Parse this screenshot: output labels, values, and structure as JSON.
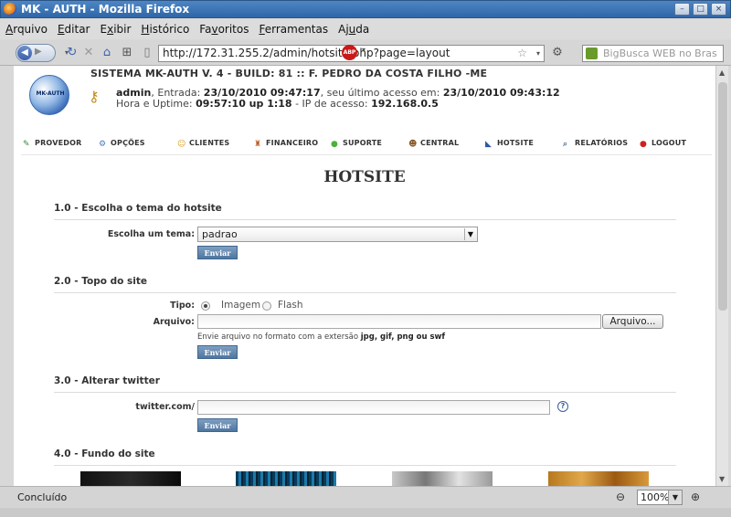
{
  "window": {
    "title": "MK - AUTH - Mozilla Firefox",
    "buttons": [
      "–",
      "□",
      "×"
    ]
  },
  "menubar": {
    "items": [
      {
        "accel": "A",
        "rest": "rquivo"
      },
      {
        "accel": "E",
        "rest": "ditar"
      },
      {
        "accel": "x",
        "pre": "E",
        "rest": "ibir"
      },
      {
        "accel": "H",
        "rest": "istórico"
      },
      {
        "accel": "v",
        "pre": "Fa",
        "rest": "oritos"
      },
      {
        "accel": "F",
        "rest": "erramentas"
      },
      {
        "accel": "u",
        "pre": "Aj",
        "rest": "da"
      }
    ]
  },
  "toolbar": {
    "url": "http://172.31.255.2/admin/hotsite.php?page=layout",
    "search_placeholder": "BigBusca WEB no Bras",
    "icons": [
      "back-icon",
      "forward-icon",
      "reload-icon",
      "stop-icon",
      "home-icon",
      "add-bookmark-icon",
      "page-icon",
      "star-icon",
      "adblock-icon",
      "addon-icon",
      "search-engine-icon"
    ],
    "adblock_label": "ABP"
  },
  "header": {
    "logo_text": "MK-AUTH",
    "system_title": "SISTEMA MK-AUTH V. 4 - BUILD: 81 :: F. PEDRO DA COSTA FILHO -ME",
    "user": "admin",
    "entrada_label": ", Entrada: ",
    "entrada": "23/10/2010 09:47:17",
    "last_access_label": ", seu último acesso em: ",
    "last_access": "23/10/2010 09:43:12",
    "uptime_label": "Hora e Uptime: ",
    "uptime": "09:57:10 up 1:18",
    "ip_label": " - IP de acesso: ",
    "ip": "192.168.0.5"
  },
  "topmenu": [
    {
      "label": "PROVEDOR",
      "icon": "provider-icon",
      "color": "#3a8a3a"
    },
    {
      "label": "OPÇÕES",
      "icon": "options-icon",
      "color": "#4a7abf"
    },
    {
      "label": "CLIENTES",
      "icon": "clients-icon",
      "color": "#d0a020"
    },
    {
      "label": "FINANCEIRO",
      "icon": "finance-icon",
      "color": "#c05a20"
    },
    {
      "label": "SUPORTE",
      "icon": "support-icon",
      "color": "#4cb03c"
    },
    {
      "label": "CENTRAL",
      "icon": "central-icon",
      "color": "#8a5a2a"
    },
    {
      "label": "HOTSITE",
      "icon": "hotsite-icon",
      "color": "#2a5aa0"
    },
    {
      "label": "RELATÓRIOS",
      "icon": "reports-icon",
      "color": "#5a7aa0"
    },
    {
      "label": "LOGOUT",
      "icon": "logout-icon",
      "color": "#d02020"
    }
  ],
  "page": {
    "title": "HOTSITE",
    "s1": {
      "heading": "1.0 - Escolha o tema do hotsite",
      "label": "Escolha um tema:",
      "value": "padrao",
      "button": "Enviar"
    },
    "s2": {
      "heading": "2.0 - Topo do site",
      "tipo_label": "Tipo:",
      "opt_imagem": "Imagem",
      "opt_flash": "Flash",
      "selected": "Imagem",
      "arquivo_label": "Arquivo:",
      "file_button": "Arquivo...",
      "hint_prefix": "Envie arquivo no formato com a extersão ",
      "hint_formats": "jpg, gif, png ou swf",
      "button": "Enviar"
    },
    "s3": {
      "heading": "3.0 - Alterar twitter",
      "label": "twitter.com/",
      "value": "",
      "help": "?",
      "button": "Enviar"
    },
    "s4": {
      "heading": "4.0 - Fundo do site",
      "thumbnails": [
        "background-dark",
        "background-blue",
        "background-gray",
        "background-orange"
      ]
    }
  },
  "statusbar": {
    "status": "Concluído",
    "zoom": "100%"
  }
}
